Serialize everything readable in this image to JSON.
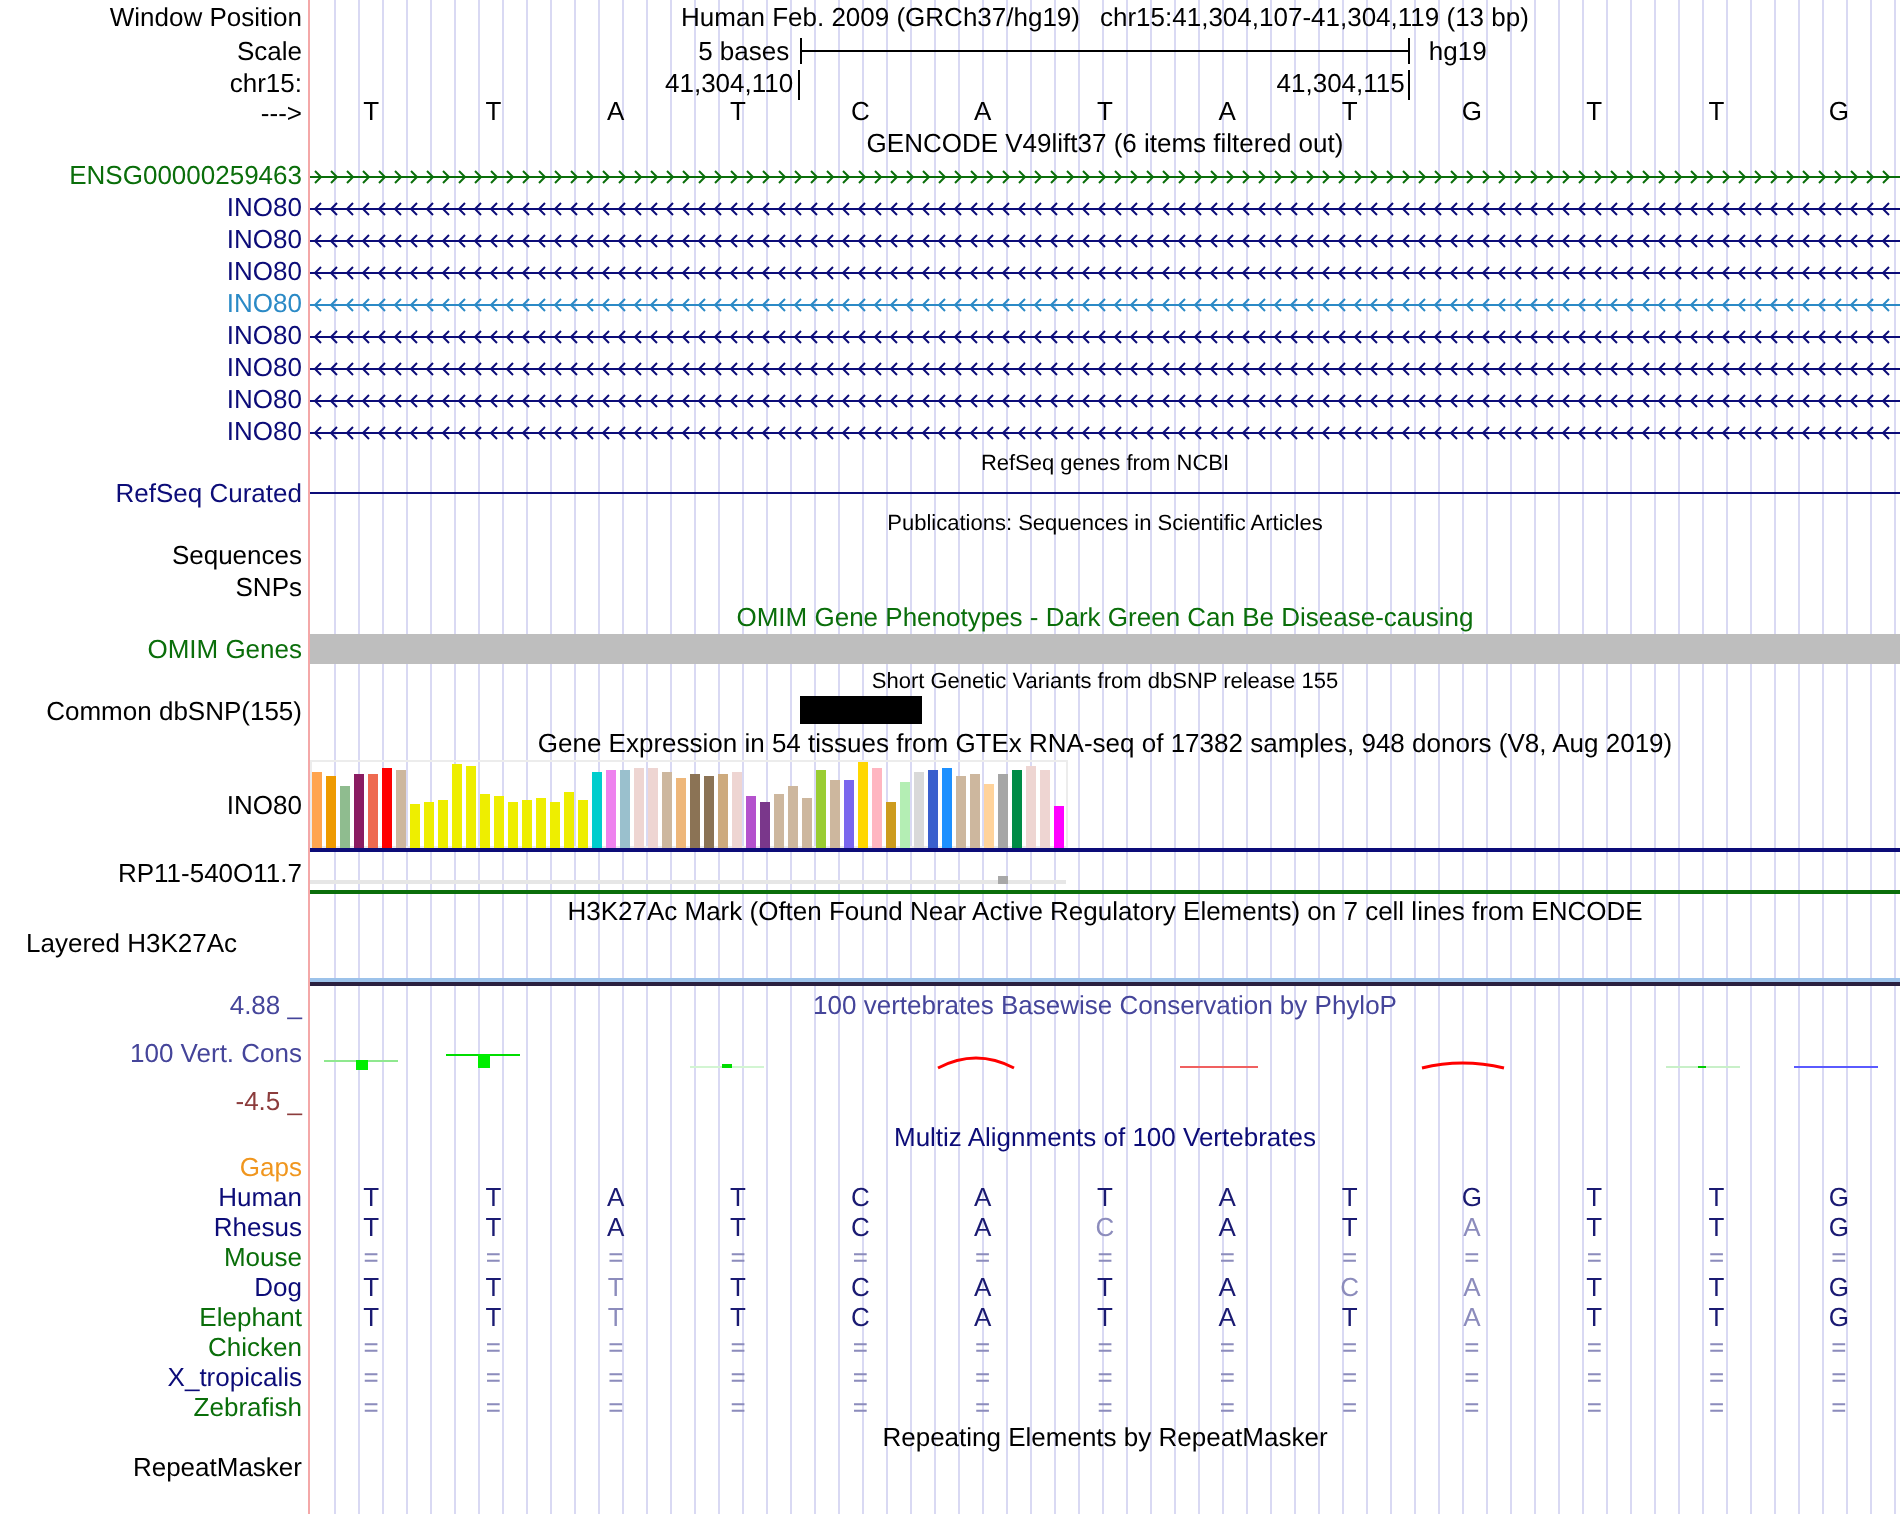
{
  "position": {
    "label": "Window Position",
    "assembly": "Human Feb. 2009 (GRCh37/hg19)",
    "range": "chr15:41,304,107-41,304,119 (13 bp)"
  },
  "scale": {
    "label": "Scale",
    "span": "5 bases",
    "database": "hg19"
  },
  "coordinates": {
    "label": "chr15:",
    "start": "41,304,110",
    "end": "41,304,115"
  },
  "sequence": {
    "label": "--->",
    "bases": [
      "T",
      "T",
      "A",
      "T",
      "C",
      "A",
      "T",
      "A",
      "T",
      "G",
      "T",
      "T",
      "G"
    ]
  },
  "gencode": {
    "title": "GENCODE V49lift37 (6 items filtered out)",
    "genes": [
      {
        "name": "ENSG00000259463",
        "kind": "forward",
        "color": "#0a6e0a"
      },
      {
        "name": "INO80",
        "kind": "reverse",
        "color": "#0c0c78"
      },
      {
        "name": "INO80",
        "kind": "reverse",
        "color": "#0c0c78"
      },
      {
        "name": "INO80",
        "kind": "reverse",
        "color": "#0c0c78"
      },
      {
        "name": "INO80",
        "kind": "reverse",
        "color": "#2b8ac6"
      },
      {
        "name": "INO80",
        "kind": "reverse",
        "color": "#0c0c78"
      },
      {
        "name": "INO80",
        "kind": "reverse",
        "color": "#0c0c78"
      },
      {
        "name": "INO80",
        "kind": "reverse",
        "color": "#0c0c78"
      },
      {
        "name": "INO80",
        "kind": "reverse",
        "color": "#0c0c78"
      }
    ]
  },
  "refseq": {
    "title": "RefSeq genes from NCBI",
    "label": "RefSeq Curated"
  },
  "publications": {
    "title": "Publications: Sequences in Scientific Articles",
    "labels": [
      "Sequences",
      "SNPs"
    ]
  },
  "omim": {
    "title": "OMIM Gene Phenotypes - Dark Green Can Be Disease-causing",
    "label": "OMIM Genes"
  },
  "dbsnp": {
    "title": "Short Genetic Variants from dbSNP release 155",
    "label": "Common dbSNP(155)"
  },
  "gtex": {
    "title": "Gene Expression in 54 tissues from GTEx RNA-seq of 17382 samples, 948 donors (V8, Aug 2019)",
    "genes": [
      {
        "name": "INO80",
        "kind": "bars",
        "color": "#0c0c78"
      },
      {
        "name": "RP11-540O11.7",
        "kind": "flat",
        "color": "#0a6e0a"
      }
    ]
  },
  "h3k27ac": {
    "title": "H3K27Ac Mark (Often Found Near Active Regulatory Elements) on 7 cell lines from ENCODE",
    "label": "Layered H3K27Ac"
  },
  "conservation": {
    "title": "100 vertebrates Basewise Conservation by PhyloP",
    "label": "100 Vert. Cons",
    "max": "4.88 _",
    "min": "-4.5 _"
  },
  "multiz": {
    "title": "Multiz Alignments of 100 Vertebrates",
    "gaps_label": "Gaps",
    "species": [
      {
        "name": "Human",
        "color": "#0c0c78",
        "bases": [
          {
            "base": "T",
            "faded": false
          },
          {
            "base": "T",
            "faded": false
          },
          {
            "base": "A",
            "faded": false
          },
          {
            "base": "T",
            "faded": false
          },
          {
            "base": "C",
            "faded": false
          },
          {
            "base": "A",
            "faded": false
          },
          {
            "base": "T",
            "faded": false
          },
          {
            "base": "A",
            "faded": false
          },
          {
            "base": "T",
            "faded": false
          },
          {
            "base": "G",
            "faded": false
          },
          {
            "base": "T",
            "faded": false
          },
          {
            "base": "T",
            "faded": false
          },
          {
            "base": "G",
            "faded": false
          }
        ]
      },
      {
        "name": "Rhesus",
        "color": "#0c0c78",
        "bases": [
          {
            "base": "T",
            "faded": false
          },
          {
            "base": "T",
            "faded": false
          },
          {
            "base": "A",
            "faded": false
          },
          {
            "base": "T",
            "faded": false
          },
          {
            "base": "C",
            "faded": false
          },
          {
            "base": "A",
            "faded": false
          },
          {
            "base": "C",
            "faded": true
          },
          {
            "base": "A",
            "faded": false
          },
          {
            "base": "T",
            "faded": false
          },
          {
            "base": "A",
            "faded": true
          },
          {
            "base": "T",
            "faded": false
          },
          {
            "base": "T",
            "faded": false
          },
          {
            "base": "G",
            "faded": false
          }
        ]
      },
      {
        "name": "Mouse",
        "color": "#0a6e0a",
        "bases": [
          {
            "base": "=",
            "faded": true
          },
          {
            "base": "=",
            "faded": true
          },
          {
            "base": "=",
            "faded": true
          },
          {
            "base": "=",
            "faded": true
          },
          {
            "base": "=",
            "faded": true
          },
          {
            "base": "=",
            "faded": true
          },
          {
            "base": "=",
            "faded": true
          },
          {
            "base": "=",
            "faded": true
          },
          {
            "base": "=",
            "faded": true
          },
          {
            "base": "=",
            "faded": true
          },
          {
            "base": "=",
            "faded": true
          },
          {
            "base": "=",
            "faded": true
          },
          {
            "base": "=",
            "faded": true
          }
        ]
      },
      {
        "name": "Dog",
        "color": "#0c0c78",
        "bases": [
          {
            "base": "T",
            "faded": false
          },
          {
            "base": "T",
            "faded": false
          },
          {
            "base": "T",
            "faded": true
          },
          {
            "base": "T",
            "faded": false
          },
          {
            "base": "C",
            "faded": false
          },
          {
            "base": "A",
            "faded": false
          },
          {
            "base": "T",
            "faded": false
          },
          {
            "base": "A",
            "faded": false
          },
          {
            "base": "C",
            "faded": true
          },
          {
            "base": "A",
            "faded": true
          },
          {
            "base": "T",
            "faded": false
          },
          {
            "base": "T",
            "faded": false
          },
          {
            "base": "G",
            "faded": false
          }
        ]
      },
      {
        "name": "Elephant",
        "color": "#0a6e0a",
        "bases": [
          {
            "base": "T",
            "faded": false
          },
          {
            "base": "T",
            "faded": false
          },
          {
            "base": "T",
            "faded": true
          },
          {
            "base": "T",
            "faded": false
          },
          {
            "base": "C",
            "faded": false
          },
          {
            "base": "A",
            "faded": false
          },
          {
            "base": "T",
            "faded": false
          },
          {
            "base": "A",
            "faded": false
          },
          {
            "base": "T",
            "faded": false
          },
          {
            "base": "A",
            "faded": true
          },
          {
            "base": "T",
            "faded": false
          },
          {
            "base": "T",
            "faded": false
          },
          {
            "base": "G",
            "faded": false
          }
        ]
      },
      {
        "name": "Chicken",
        "color": "#0a6e0a",
        "bases": [
          {
            "base": "=",
            "faded": true
          },
          {
            "base": "=",
            "faded": true
          },
          {
            "base": "=",
            "faded": true
          },
          {
            "base": "=",
            "faded": true
          },
          {
            "base": "=",
            "faded": true
          },
          {
            "base": "=",
            "faded": true
          },
          {
            "base": "=",
            "faded": true
          },
          {
            "base": "=",
            "faded": true
          },
          {
            "base": "=",
            "faded": true
          },
          {
            "base": "=",
            "faded": true
          },
          {
            "base": "=",
            "faded": true
          },
          {
            "base": "=",
            "faded": true
          },
          {
            "base": "=",
            "faded": true
          }
        ]
      },
      {
        "name": "X_tropicalis",
        "color": "#0c0c78",
        "bases": [
          {
            "base": "=",
            "faded": true
          },
          {
            "base": "=",
            "faded": true
          },
          {
            "base": "=",
            "faded": true
          },
          {
            "base": "=",
            "faded": true
          },
          {
            "base": "=",
            "faded": true
          },
          {
            "base": "=",
            "faded": true
          },
          {
            "base": "=",
            "faded": true
          },
          {
            "base": "=",
            "faded": true
          },
          {
            "base": "=",
            "faded": true
          },
          {
            "base": "=",
            "faded": true
          },
          {
            "base": "=",
            "faded": true
          },
          {
            "base": "=",
            "faded": true
          },
          {
            "base": "=",
            "faded": true
          }
        ]
      },
      {
        "name": "Zebrafish",
        "color": "#0a6e0a",
        "bases": [
          {
            "base": "=",
            "faded": true
          },
          {
            "base": "=",
            "faded": true
          },
          {
            "base": "=",
            "faded": true
          },
          {
            "base": "=",
            "faded": true
          },
          {
            "base": "=",
            "faded": true
          },
          {
            "base": "=",
            "faded": true
          },
          {
            "base": "=",
            "faded": true
          },
          {
            "base": "=",
            "faded": true
          },
          {
            "base": "=",
            "faded": true
          },
          {
            "base": "=",
            "faded": true
          },
          {
            "base": "=",
            "faded": true
          },
          {
            "base": "=",
            "faded": true
          },
          {
            "base": "=",
            "faded": true
          }
        ]
      }
    ]
  },
  "repeatmasker": {
    "title": "Repeating Elements by RepeatMasker",
    "label": "RepeatMasker"
  }
}
